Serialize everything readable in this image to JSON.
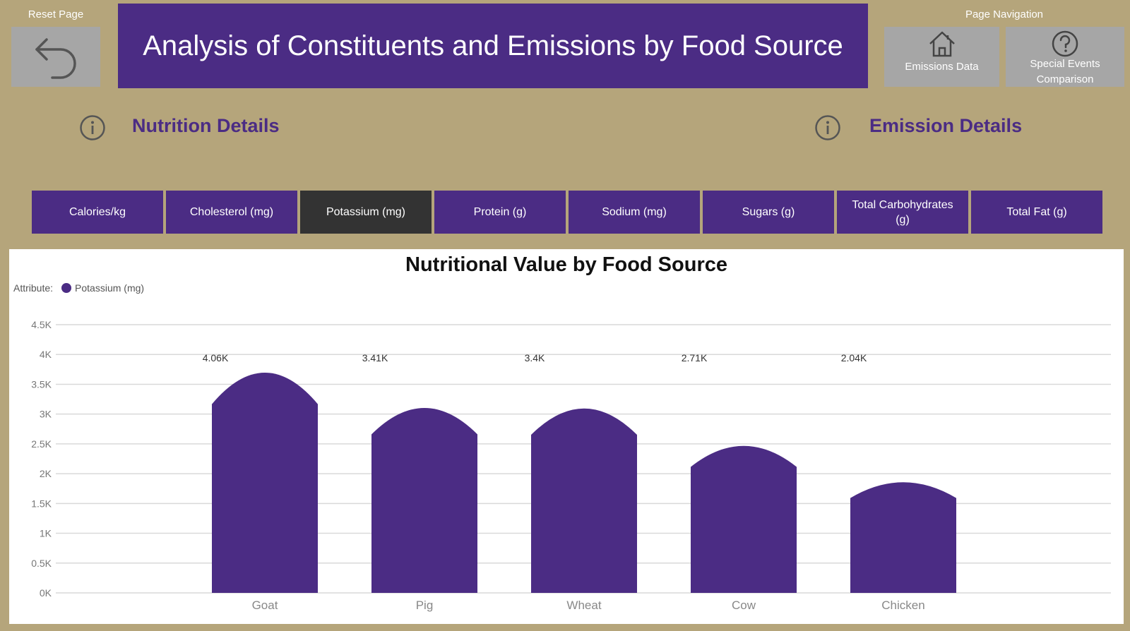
{
  "header": {
    "reset_label": "Reset Page",
    "title": "Analysis of Constituents and Emissions by Food Source",
    "nav_label": "Page Navigation",
    "nav_buttons": [
      {
        "label_line1": "Emissions Data",
        "label_line2": "",
        "icon": "home-icon"
      },
      {
        "label_line1": "Special Events",
        "label_line2": "Comparison",
        "icon": "help-circle-icon"
      }
    ]
  },
  "sections": {
    "nutrition_title": "Nutrition Details",
    "emission_title": "Emission Details"
  },
  "slicer": {
    "items": [
      {
        "line1": "Calories/kg",
        "line2": ""
      },
      {
        "line1": "Cholesterol (mg)",
        "line2": ""
      },
      {
        "line1": "Potassium (mg)",
        "line2": ""
      },
      {
        "line1": "Protein (g)",
        "line2": ""
      },
      {
        "line1": "Sodium (mg)",
        "line2": ""
      },
      {
        "line1": "Sugars (g)",
        "line2": ""
      },
      {
        "line1": "Total Carbohydrates",
        "line2": "(g)"
      },
      {
        "line1": "Total Fat (g)",
        "line2": ""
      }
    ],
    "selected": "Potassium (mg)"
  },
  "colors": {
    "accent": "#4b2c84",
    "background": "#b5a57b",
    "selected": "#333333",
    "button_gray": "#a6a6a6"
  },
  "chart_data": {
    "type": "bar",
    "title": "Nutritional Value by Food Source",
    "legend_prefix": "Attribute:",
    "legend_placement": "top-left",
    "series": [
      {
        "name": "Potassium (mg)",
        "values": [
          4060,
          3410,
          3400,
          2710,
          2040
        ]
      }
    ],
    "categories": [
      "Goat",
      "Pig",
      "Wheat",
      "Cow",
      "Chicken"
    ],
    "category_icons": [
      "goat-silhouette",
      "pig-silhouette",
      "tree-silhouette",
      "cow-silhouette",
      "chicken-silhouette"
    ],
    "data_labels": [
      "4.06K",
      "3.41K",
      "3.4K",
      "2.71K",
      "2.04K"
    ],
    "yticks": [
      "0K",
      "0.5K",
      "1K",
      "1.5K",
      "2K",
      "2.5K",
      "3K",
      "3.5K",
      "4K",
      "4.5K"
    ],
    "ylim": [
      0,
      4500
    ],
    "grid": true,
    "color": "#4b2c84"
  }
}
